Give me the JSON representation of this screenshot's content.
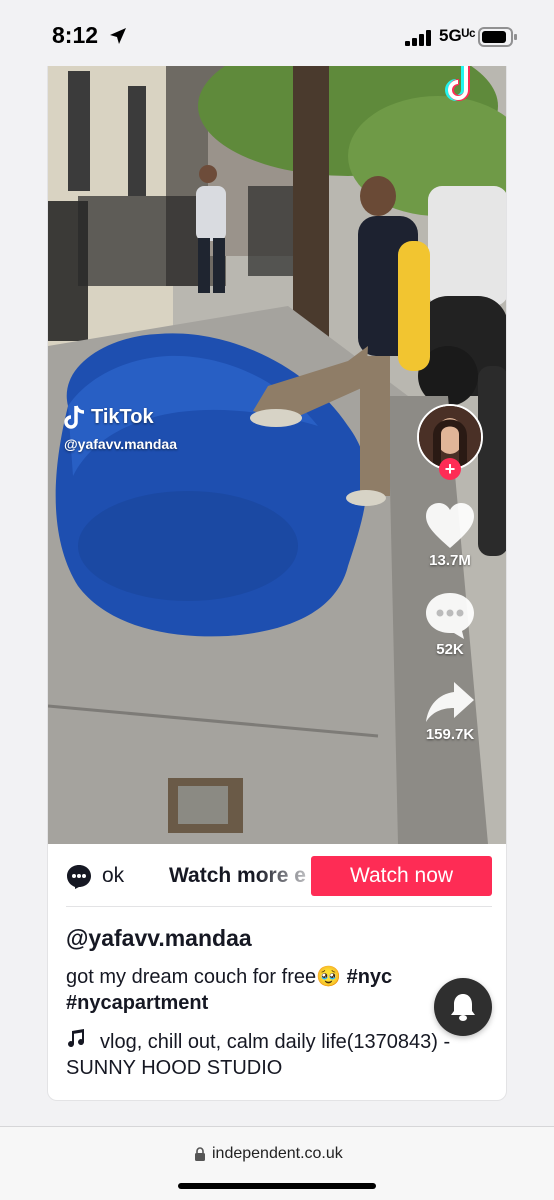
{
  "status_bar": {
    "time": "8:12",
    "network": "5Gᵁᶜ",
    "icons": [
      "location-arrow-icon",
      "signal-icon",
      "battery-icon"
    ]
  },
  "video": {
    "watermark_brand": "TikTok",
    "watermark_handle": "@yafavv.mandaa",
    "likes": "13.7M",
    "comments": "52K",
    "shares": "159.7K"
  },
  "cta": {
    "partial_text": "ok",
    "watch_more": "Watch more e",
    "watch_now": "Watch now"
  },
  "post": {
    "author": "@yafavv.mandaa",
    "caption_text": "got my dream couch for free🥹 ",
    "hashtag1": "#nyc",
    "hashtag2": "#nycapartment",
    "music": "vlog, chill out, calm daily life(1370843) - SUNNY HOOD STUDIO"
  },
  "browser": {
    "url": "independent.co.uk"
  },
  "colors": {
    "accent": "#fe2c55",
    "couch": "#1e4fb0"
  }
}
